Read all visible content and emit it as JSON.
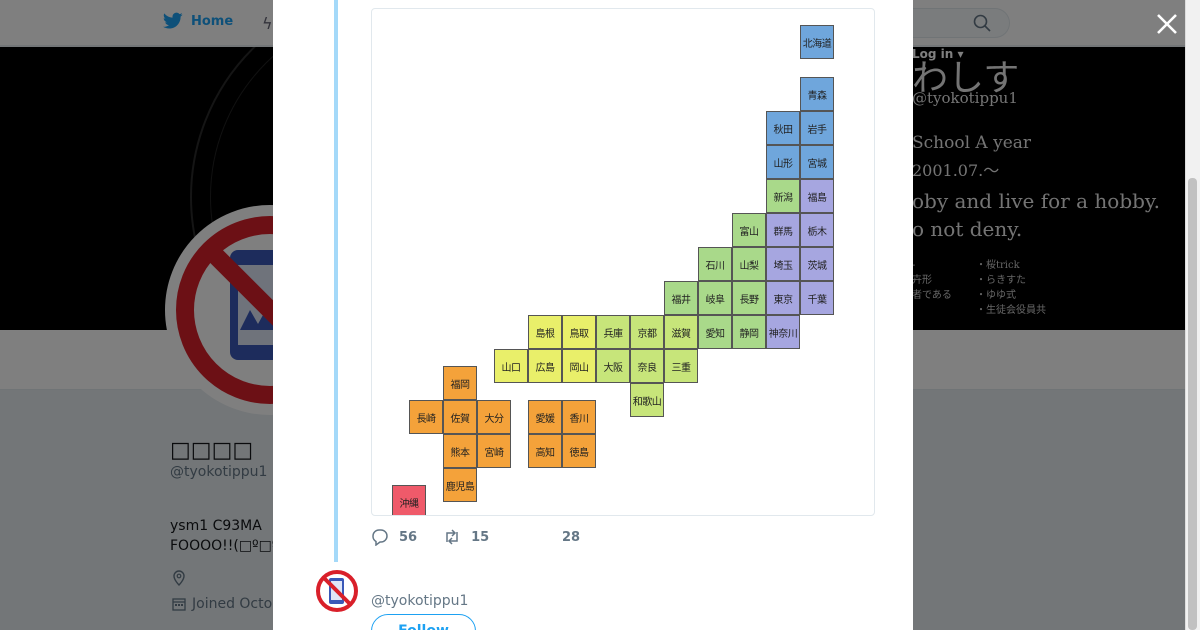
{
  "nav": {
    "home_label": "Home"
  },
  "banner": {
    "title": "わしす",
    "handle": "@tyokotippu1",
    "line1": "School A year",
    "line2": "2001.07.～",
    "line3": "oby and live for a hobby.",
    "line4": "o not deny.",
    "login": "Log in ▾",
    "small_left": "‐\n卉形\n者である",
    "small_right": "・桜trick\n・らきすた\n・ゆゆ式\n・生徒会役員共"
  },
  "profile": {
    "name": "□□□□",
    "handle": "@tyokotippu1",
    "bio_line1": "ysm1 C93MA",
    "bio_line2": "FOOOO!!(□º□º□",
    "joined": "Joined Octo"
  },
  "map": {
    "prefectures": [
      {
        "name": "北海道",
        "color": "#6fa6dc"
      },
      {
        "name": "青森",
        "color": "#6fa6dc"
      },
      {
        "name": "秋田",
        "color": "#6fa6dc"
      },
      {
        "name": "岩手",
        "color": "#6fa6dc"
      },
      {
        "name": "山形",
        "color": "#6fa6dc"
      },
      {
        "name": "宮城",
        "color": "#6fa6dc"
      },
      {
        "name": "新潟",
        "color": "#a9d98a"
      },
      {
        "name": "福島",
        "color": "#a6a6e0"
      },
      {
        "name": "富山",
        "color": "#a9d98a"
      },
      {
        "name": "群馬",
        "color": "#a6a6e0"
      },
      {
        "name": "栃木",
        "color": "#a6a6e0"
      },
      {
        "name": "石川",
        "color": "#a9d98a"
      },
      {
        "name": "山梨",
        "color": "#a9d98a"
      },
      {
        "name": "埼玉",
        "color": "#a6a6e0"
      },
      {
        "name": "茨城",
        "color": "#a6a6e0"
      },
      {
        "name": "福井",
        "color": "#a9d98a"
      },
      {
        "name": "岐阜",
        "color": "#a9d98a"
      },
      {
        "name": "長野",
        "color": "#a9d98a"
      },
      {
        "name": "東京",
        "color": "#a6a6e0"
      },
      {
        "name": "千葉",
        "color": "#a6a6e0"
      },
      {
        "name": "島根",
        "color": "#e9ef6a"
      },
      {
        "name": "鳥取",
        "color": "#e9ef6a"
      },
      {
        "name": "兵庫",
        "color": "#c7e57a"
      },
      {
        "name": "京都",
        "color": "#c7e57a"
      },
      {
        "name": "滋賀",
        "color": "#c7e57a"
      },
      {
        "name": "愛知",
        "color": "#a9d98a"
      },
      {
        "name": "静岡",
        "color": "#a9d98a"
      },
      {
        "name": "神奈川",
        "color": "#a6a6e0"
      },
      {
        "name": "山口",
        "color": "#e9ef6a"
      },
      {
        "name": "広島",
        "color": "#e9ef6a"
      },
      {
        "name": "岡山",
        "color": "#e9ef6a"
      },
      {
        "name": "大阪",
        "color": "#c7e57a"
      },
      {
        "name": "奈良",
        "color": "#c7e57a"
      },
      {
        "name": "三重",
        "color": "#c7e57a"
      },
      {
        "name": "和歌山",
        "color": "#c7e57a"
      },
      {
        "name": "福岡",
        "color": "#f4a23a"
      },
      {
        "name": "長崎",
        "color": "#f4a23a"
      },
      {
        "name": "佐賀",
        "color": "#f4a23a"
      },
      {
        "name": "大分",
        "color": "#f4a23a"
      },
      {
        "name": "愛媛",
        "color": "#f4a23a"
      },
      {
        "name": "香川",
        "color": "#f4a23a"
      },
      {
        "name": "熊本",
        "color": "#f4a23a"
      },
      {
        "name": "宮崎",
        "color": "#f4a23a"
      },
      {
        "name": "高知",
        "color": "#f4a23a"
      },
      {
        "name": "徳島",
        "color": "#f4a23a"
      },
      {
        "name": "鹿児島",
        "color": "#f4a23a"
      },
      {
        "name": "沖縄",
        "color": "#ef5a6a"
      }
    ]
  },
  "tweet_actions": {
    "replies": "56",
    "retweets": "15",
    "likes": "28"
  },
  "reply": {
    "handle": "@tyokotippu1",
    "follow_label": "Follow"
  },
  "colors": {
    "accent": "#1da1f2",
    "thread_line": "#a4d9f9"
  }
}
